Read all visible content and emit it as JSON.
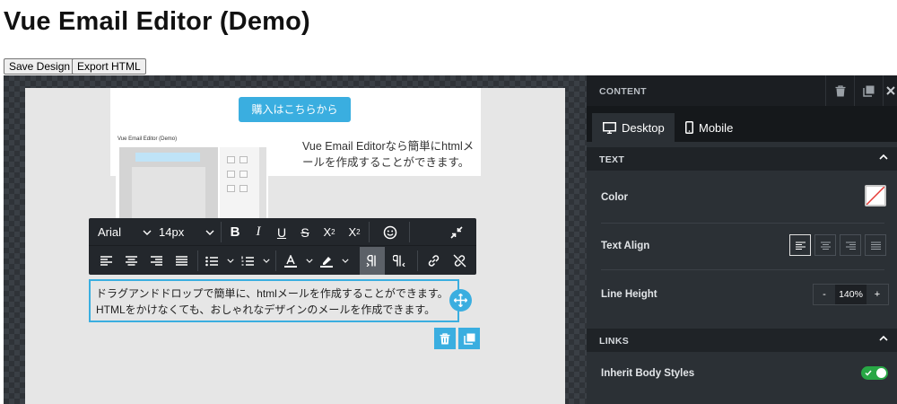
{
  "page": {
    "title": "Vue Email Editor (Demo)",
    "save_label": "Save Design",
    "export_label": "Export HTML"
  },
  "email": {
    "buy_button": "購入はこちらから",
    "thumbnail_title": "Vue Email Editor (Demo)",
    "side_text": "Vue Email Editorなら簡単にhtmlメールを作成することができます。",
    "selected_text_line1": "ドラグアンドドロップで簡単に、htmlメールを作成することができます。",
    "selected_text_line2": "HTMLをかけなくても、おしゃれなデザインのメールを作成できます。"
  },
  "toolbar": {
    "font_family": "Arial",
    "font_size": "14px",
    "icons_row1": [
      "bold-icon",
      "italic-icon",
      "underline-icon",
      "strikethrough-icon",
      "superscript-icon",
      "subscript-icon",
      "emoji-icon",
      "collapse-icon"
    ],
    "icons_row2": [
      "align-left-icon",
      "align-center-icon",
      "align-right-icon",
      "align-justify-icon",
      "bullet-list-icon",
      "numbered-list-icon",
      "text-color-icon",
      "highlight-icon",
      "ltr-icon",
      "rtl-icon",
      "link-icon",
      "unlink-icon"
    ]
  },
  "panel": {
    "title": "CONTENT",
    "tabs": [
      {
        "label": "Desktop",
        "active": true
      },
      {
        "label": "Mobile",
        "active": false
      }
    ],
    "text_section": "TEXT",
    "color_label": "Color",
    "text_align_label": "Text Align",
    "line_height_label": "Line Height",
    "line_height_value": "140%",
    "minus": "-",
    "plus": "+",
    "links_section": "LINKS",
    "inherit_label": "Inherit Body Styles",
    "inherit_enabled": true
  },
  "colors": {
    "accent": "#3aaee0",
    "panel_bg": "#2b3035",
    "toggle_on": "#28a745"
  }
}
